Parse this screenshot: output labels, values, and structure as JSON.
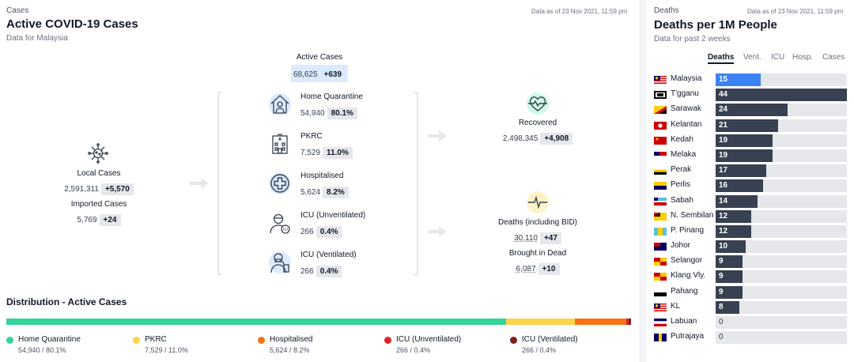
{
  "left": {
    "kicker": "Cases",
    "title": "Active COVID-19 Cases",
    "subtitle": "Data for Malaysia",
    "asof": "Data as of 23 Nov 2021, 11:59 pm",
    "local": {
      "label": "Local Cases",
      "value": "2,591,311",
      "change": "+5,570"
    },
    "imported": {
      "label": "Imported Cases",
      "value": "5,769",
      "change": "+24"
    },
    "active": {
      "label": "Active Cases",
      "value": "68,625",
      "change": "+639"
    },
    "items": [
      {
        "label": "Home Quarantine",
        "value": "54,940",
        "pct": "80.1%"
      },
      {
        "label": "PKRC",
        "value": "7,529",
        "pct": "11.0%"
      },
      {
        "label": "Hospitalised",
        "value": "5,624",
        "pct": "8.2%"
      },
      {
        "label": "ICU (Unventilated)",
        "value": "266",
        "pct": "0.4%"
      },
      {
        "label": "ICU (Ventilated)",
        "value": "266",
        "pct": "0.4%"
      }
    ],
    "recovered": {
      "label": "Recovered",
      "value": "2,498,345",
      "change": "+4,908"
    },
    "deaths": {
      "label": "Deaths (including BID)",
      "value": "30,110",
      "change": "+47"
    },
    "bid": {
      "label": "Brought in Dead",
      "value": "6,087",
      "change": "+10"
    },
    "distribution": {
      "title": "Distribution - Active Cases",
      "segments": [
        {
          "label": "Home Quarantine",
          "detail": "54,940 / 80.1%",
          "share": 80.1,
          "color": "#34d399"
        },
        {
          "label": "PKRC",
          "detail": "7,529 / 11.0%",
          "share": 11.0,
          "color": "#fcd34d"
        },
        {
          "label": "Hospitalised",
          "detail": "5,624 / 8.2%",
          "share": 8.2,
          "color": "#f97316"
        },
        {
          "label": "ICU (Unventilated)",
          "detail": "266 / 0.4%",
          "share": 0.4,
          "color": "#dc2626"
        },
        {
          "label": "ICU (Ventilated)",
          "detail": "266 / 0.4%",
          "share": 0.4,
          "color": "#7f1d1d"
        }
      ]
    }
  },
  "right": {
    "kicker": "Deaths",
    "asof": "Data as of 23 Nov 2021, 11:59 pm",
    "title": "Deaths per 1M People",
    "subtitle": "Data for past 2 weeks",
    "tabs": [
      {
        "label": "Deaths",
        "active": true
      },
      {
        "label": "Vent.",
        "active": false
      },
      {
        "label": "ICU",
        "active": false
      },
      {
        "label": "Hosp.",
        "active": false
      },
      {
        "label": "Cases",
        "active": false
      }
    ],
    "max": 44,
    "states": [
      {
        "name": "Malaysia",
        "value": 15,
        "highlight": true,
        "flag": "malaysia"
      },
      {
        "name": "T'gganu",
        "value": 44,
        "flag": "terengganu"
      },
      {
        "name": "Sarawak",
        "value": 24,
        "flag": "sarawak"
      },
      {
        "name": "Kelantan",
        "value": 21,
        "flag": "kelantan"
      },
      {
        "name": "Kedah",
        "value": 19,
        "flag": "kedah"
      },
      {
        "name": "Melaka",
        "value": 19,
        "flag": "melaka"
      },
      {
        "name": "Perak",
        "value": 17,
        "flag": "perak"
      },
      {
        "name": "Perlis",
        "value": 16,
        "flag": "perlis"
      },
      {
        "name": "Sabah",
        "value": 14,
        "flag": "sabah"
      },
      {
        "name": "N. Sembilan",
        "value": 12,
        "flag": "nsembilan"
      },
      {
        "name": "P. Pinang",
        "value": 12,
        "flag": "penang"
      },
      {
        "name": "Johor",
        "value": 10,
        "flag": "johor"
      },
      {
        "name": "Selangor",
        "value": 9,
        "flag": "selangor"
      },
      {
        "name": "Klang Vly.",
        "value": 9,
        "flag": "klangvalley"
      },
      {
        "name": "Pahang",
        "value": 9,
        "flag": "pahang"
      },
      {
        "name": "KL",
        "value": 8,
        "flag": "kl"
      },
      {
        "name": "Labuan",
        "value": 0,
        "flag": "labuan"
      },
      {
        "name": "Putrajaya",
        "value": 0,
        "flag": "putrajaya"
      }
    ]
  }
}
